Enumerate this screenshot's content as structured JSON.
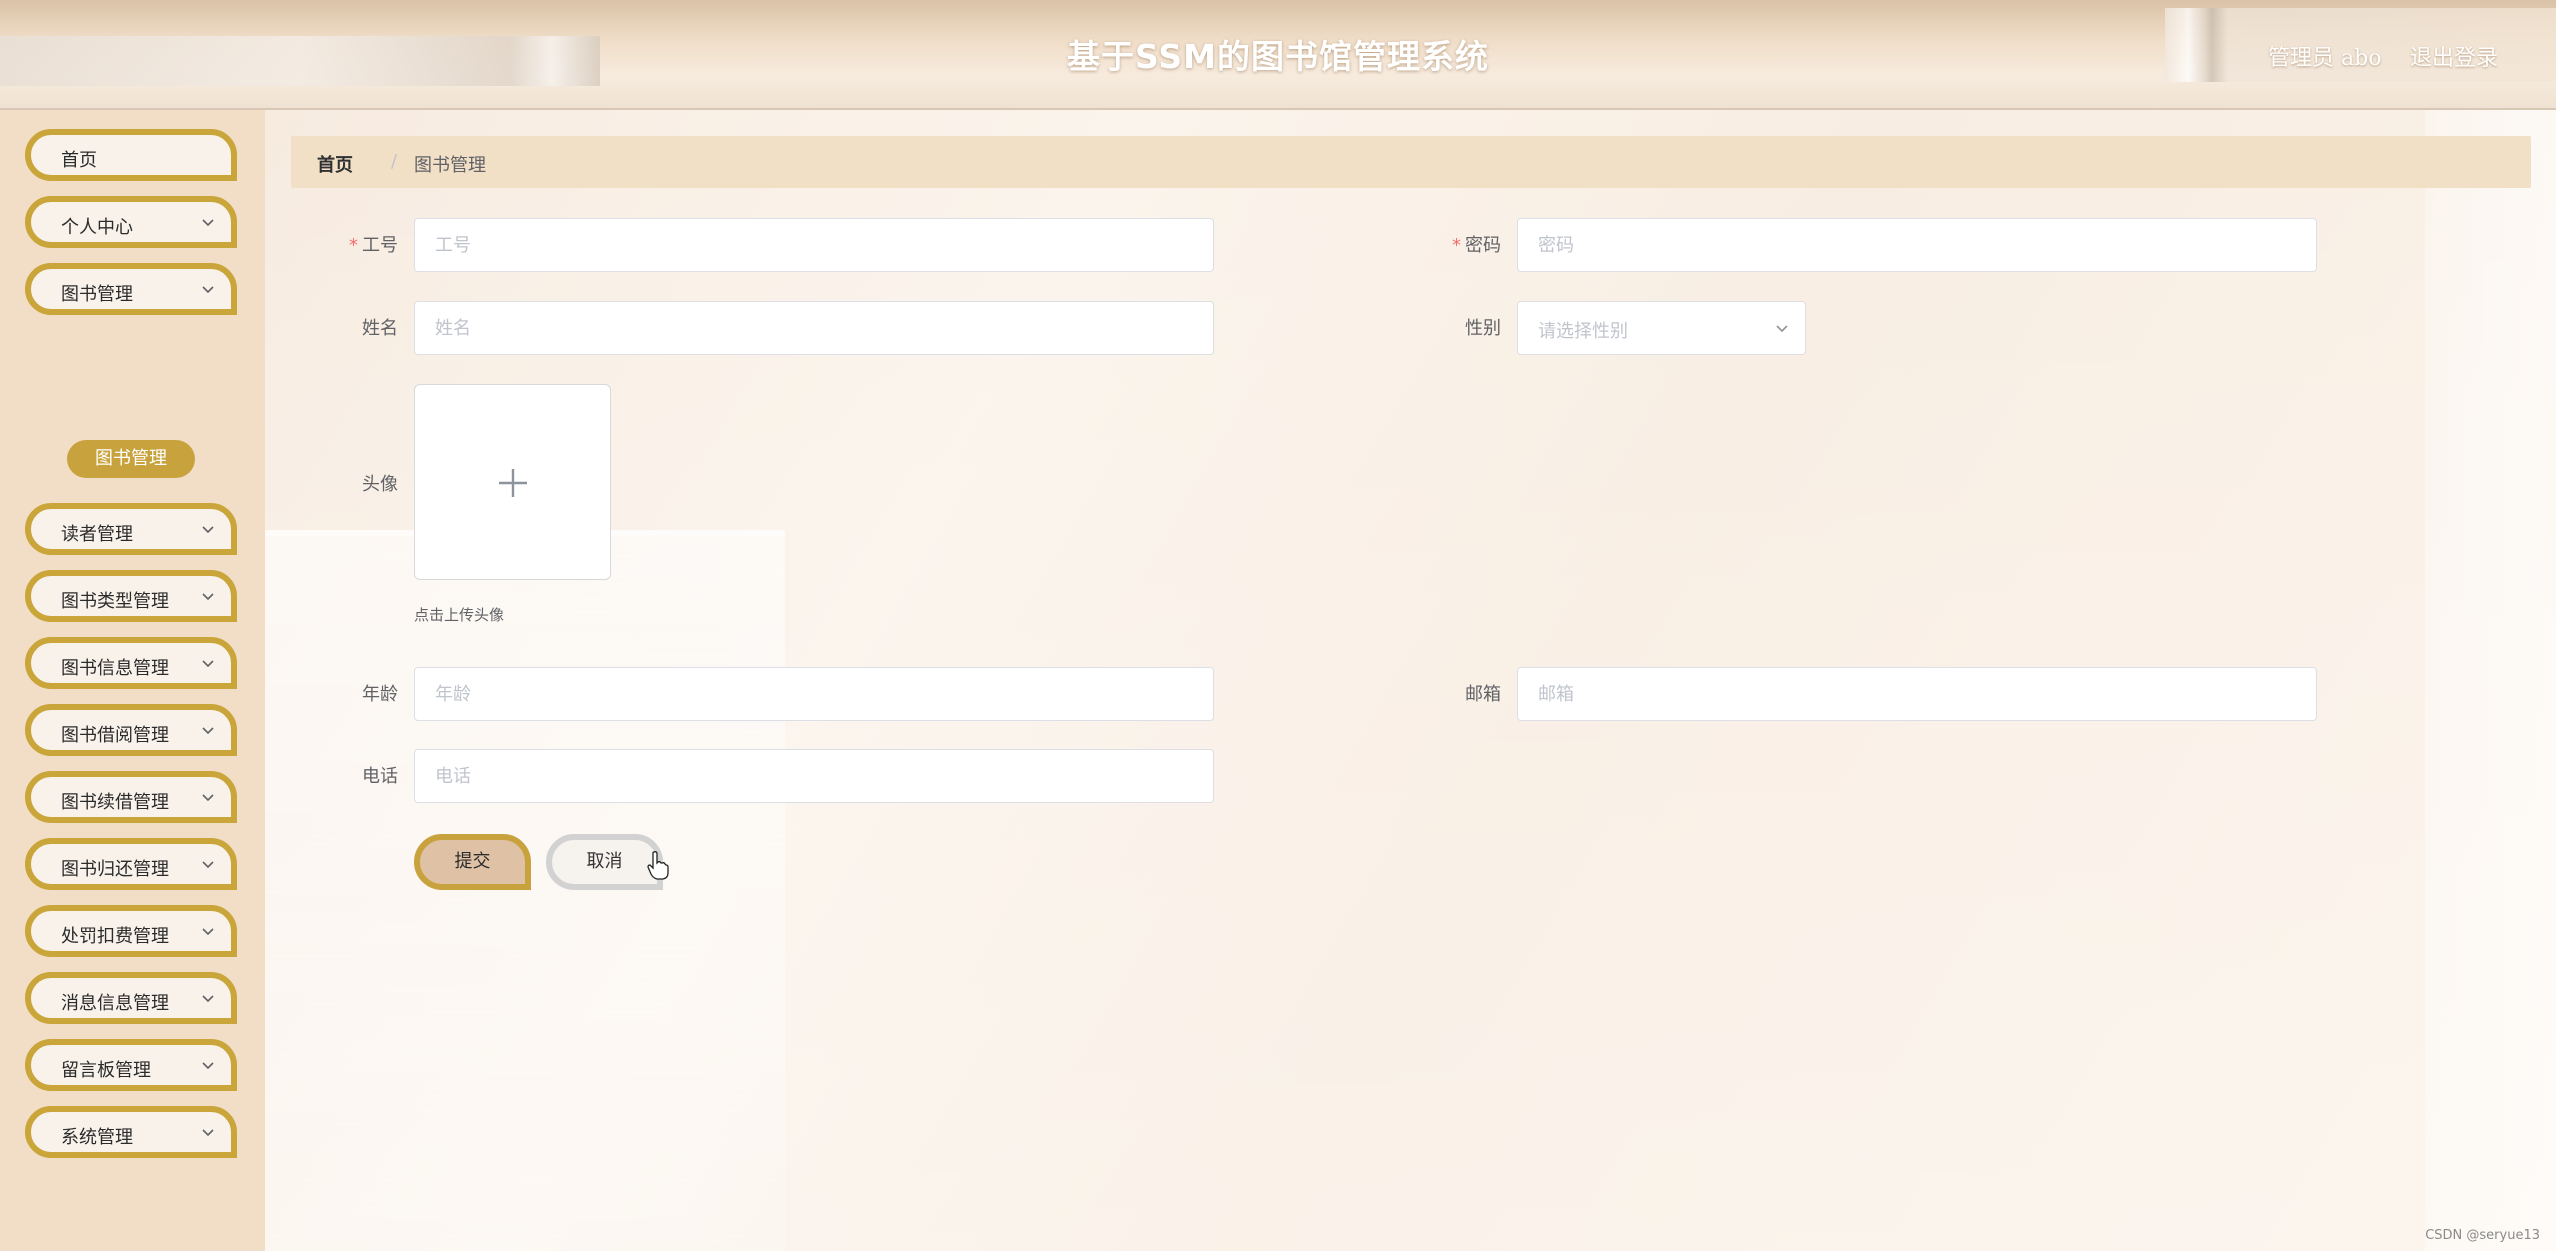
{
  "header": {
    "title": "基于SSM的图书馆管理系统",
    "user_label": "管理员 abo",
    "logout_label": "退出登录"
  },
  "sidebar": {
    "items": [
      {
        "label": "首页",
        "has_chevron": false
      },
      {
        "label": "个人中心",
        "has_chevron": true
      },
      {
        "label": "图书管理",
        "has_chevron": true
      },
      {
        "label": "读者管理",
        "has_chevron": true
      },
      {
        "label": "图书类型管理",
        "has_chevron": true
      },
      {
        "label": "图书信息管理",
        "has_chevron": true
      },
      {
        "label": "图书借阅管理",
        "has_chevron": true
      },
      {
        "label": "图书续借管理",
        "has_chevron": true
      },
      {
        "label": "图书归还管理",
        "has_chevron": true
      },
      {
        "label": "处罚扣费管理",
        "has_chevron": true
      },
      {
        "label": "消息信息管理",
        "has_chevron": true
      },
      {
        "label": "留言板管理",
        "has_chevron": true
      },
      {
        "label": "系统管理",
        "has_chevron": true
      }
    ],
    "active_submenu": "图书管理"
  },
  "breadcrumb": {
    "home": "首页",
    "separator": "/",
    "current": "图书管理"
  },
  "form": {
    "gonghao": {
      "label": "工号",
      "placeholder": "工号",
      "required": true
    },
    "mima": {
      "label": "密码",
      "placeholder": "密码",
      "required": true
    },
    "xingming": {
      "label": "姓名",
      "placeholder": "姓名"
    },
    "xingbie": {
      "label": "性别",
      "placeholder": "请选择性别"
    },
    "touxiang": {
      "label": "头像",
      "tip": "点击上传头像"
    },
    "nianling": {
      "label": "年龄",
      "placeholder": "年龄"
    },
    "youxiang": {
      "label": "邮箱",
      "placeholder": "邮箱"
    },
    "dianhua": {
      "label": "电话",
      "placeholder": "电话"
    },
    "submit_label": "提交",
    "cancel_label": "取消",
    "required_mark": "*"
  },
  "colors": {
    "accent_gold": "#c8a33d",
    "sidebar_bg": "#f2dec6",
    "breadcrumb_bg": "#f1dfc6",
    "required": "#f56c6c"
  },
  "watermark": "CSDN @seryue13"
}
